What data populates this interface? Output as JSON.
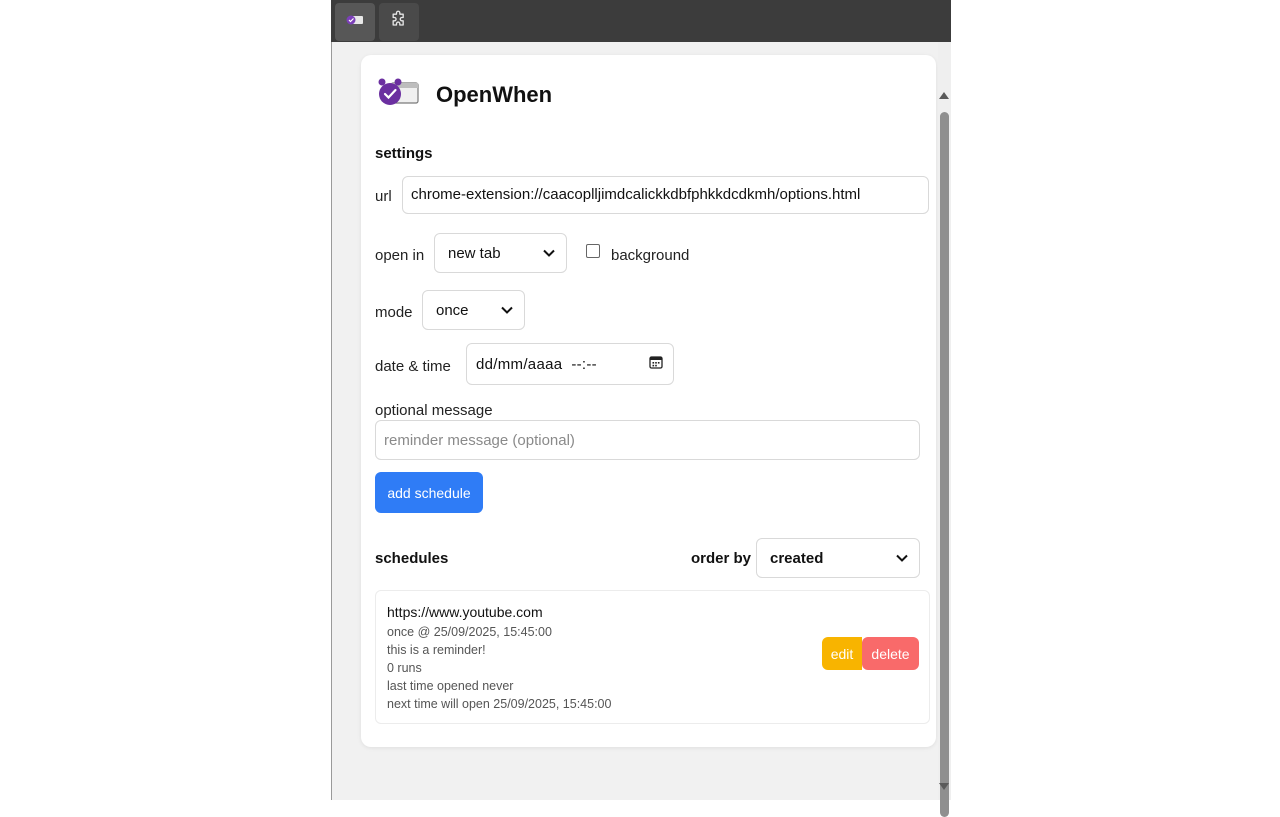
{
  "app": {
    "title": "OpenWhen"
  },
  "settings": {
    "title": "settings",
    "url_label": "url",
    "url_value": "chrome-extension://caacoplljimdcalickkdbfphkkdcdkmh/options.html",
    "open_in_label": "open in",
    "open_in_value": "new tab",
    "background_label": "background",
    "background_checked": false,
    "mode_label": "mode",
    "mode_value": "once",
    "datetime_label": "date & time",
    "datetime_value": "dd/mm/aaaa  --:--",
    "message_label": "optional message",
    "message_placeholder": "reminder message (optional)",
    "add_button": "add schedule"
  },
  "schedules": {
    "title": "schedules",
    "order_by_label": "order by",
    "order_by_value": "created",
    "items": [
      {
        "url": "https://www.youtube.com",
        "when": "once @ 25/09/2025, 15:45:00",
        "message": "this is a reminder!",
        "runs": "0 runs",
        "last_opened": "last time opened never",
        "next_open": "next time will open 25/09/2025, 15:45:00",
        "edit_label": "edit",
        "delete_label": "delete"
      }
    ]
  },
  "icons": {
    "app_logo": "alarm-clock-window-icon",
    "tab_active": "openwhen-extension-icon",
    "tab_extensions": "puzzle-icon",
    "calendar": "calendar-icon",
    "dropdown": "chevron-down-icon"
  },
  "colors": {
    "primary": "#2f7cf6",
    "edit": "#f8b400",
    "delete": "#f96a6a",
    "logo_purple": "#6b2fa0"
  }
}
